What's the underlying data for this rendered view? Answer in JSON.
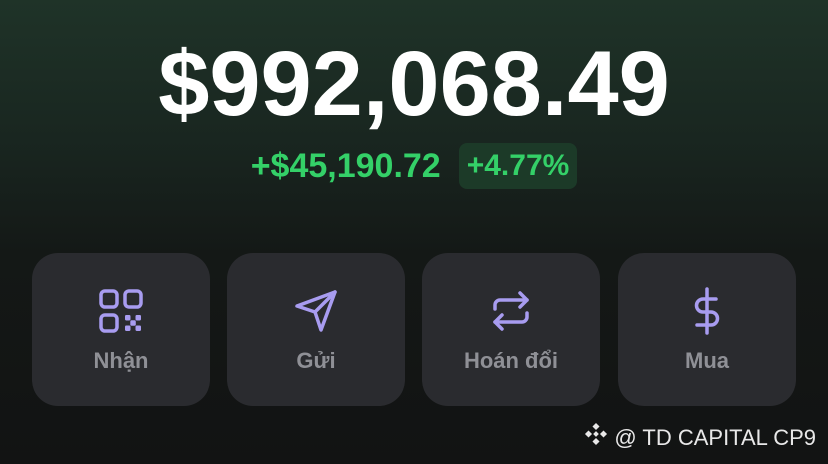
{
  "balance": {
    "total": "$992,068.49",
    "change_amount": "+$45,190.72",
    "change_percent": "+4.77%"
  },
  "actions": [
    {
      "label": "Nhận",
      "icon": "qr-code-icon"
    },
    {
      "label": "Gửi",
      "icon": "send-icon"
    },
    {
      "label": "Hoán đổi",
      "icon": "swap-icon"
    },
    {
      "label": "Mua",
      "icon": "dollar-icon"
    }
  ],
  "watermark": {
    "text": "@ TD CAPITAL CP9",
    "icon": "binance-logo-icon"
  },
  "colors": {
    "positive": "#34d068",
    "icon_accent": "#a89cf0",
    "card_bg": "#2a2b2f",
    "label": "#8f9096"
  }
}
